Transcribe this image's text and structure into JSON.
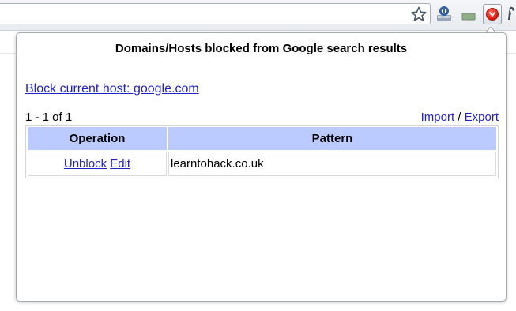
{
  "popup": {
    "title": "Domains/Hosts blocked from Google search results",
    "block_current_host": "Block current host: google.com",
    "count": "1 - 1 of 1",
    "import_label": "Import",
    "separator": " / ",
    "export_label": "Export"
  },
  "table": {
    "headers": [
      "Operation",
      "Pattern"
    ],
    "rows": [
      {
        "unblock_label": "Unblock",
        "edit_label": "Edit",
        "pattern": "learntohack.co.uk"
      }
    ]
  },
  "toolbar": {
    "icons": [
      "star-icon",
      "extension-icon",
      "extension-icon",
      "blocker-extension-icon",
      "wrench-icon"
    ]
  },
  "colors": {
    "header_bg": "#bccbff",
    "link": "#2222cc",
    "blocker_red": "#d4180a"
  }
}
